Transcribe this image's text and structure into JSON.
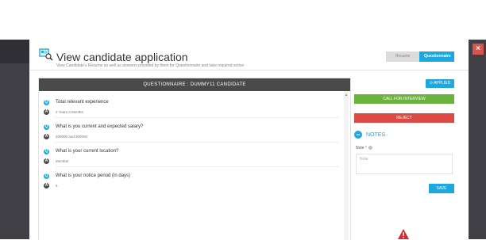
{
  "modal": {
    "title": "View candidate application",
    "subtitle": "View Candidate's Resume as well as answers provided by them for Questionnaire and take required action",
    "tabs": [
      {
        "label": "Resume",
        "active": false
      },
      {
        "label": "Questionnaire",
        "active": true
      }
    ]
  },
  "questionnaire": {
    "header": "QUESTIONNAIRE : DUMMY11 CANDIDATE",
    "items": [
      {
        "q_badge": "Q",
        "question": "Total relevant experience",
        "a_badge": "A",
        "answer": "2 Years 3 Months"
      },
      {
        "q_badge": "Q",
        "question": "What is you current and expected salary?",
        "a_badge": "A",
        "answer": "200000 and 300000"
      },
      {
        "q_badge": "Q",
        "question": "What is your current location?",
        "a_badge": "A",
        "answer": "Mumbai"
      },
      {
        "q_badge": "Q",
        "question": "What is your notice period (in days)",
        "a_badge": "A",
        "answer": "5"
      }
    ]
  },
  "actions": {
    "status_label": "APPLIED",
    "call_label": "CALL FOR INTERVIEW",
    "reject_label": "REJECT"
  },
  "notes": {
    "title": "NOTES",
    "field_label": "Note",
    "required_mark": "*",
    "placeholder": "Note",
    "save_label": "SAVE"
  },
  "colors": {
    "accent": "#1fa7e0",
    "success": "#6cb33e",
    "danger": "#db4a45",
    "dark": "#4a4a4a"
  },
  "icons": {
    "header": "candidate-search-icon",
    "applied": "check-circle-icon",
    "notes": "minus-circle-icon",
    "close": "close-icon",
    "warning": "warning-icon"
  }
}
